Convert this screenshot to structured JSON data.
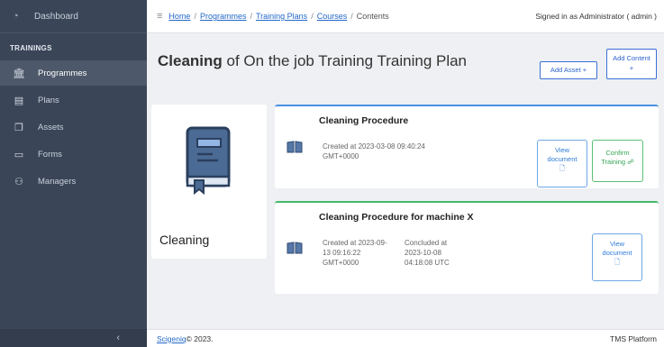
{
  "sidebar": {
    "dashboard": "Dashboard",
    "section": "TRAININGS",
    "items": [
      {
        "label": "Programmes"
      },
      {
        "label": "Plans"
      },
      {
        "label": "Assets"
      },
      {
        "label": "Forms"
      },
      {
        "label": "Managers"
      }
    ]
  },
  "header": {
    "breadcrumb": [
      "Home",
      "Programmes",
      "Training Plans",
      "Courses",
      "Contents"
    ],
    "signed_in": "Signed in as Administrator ( admin )"
  },
  "main": {
    "title_bold": "Cleaning",
    "title_rest": " of On the job Training Training Plan",
    "add_asset": "Add Asset +",
    "add_content_line1": "Add Content",
    "add_content_line2": "+",
    "course_name": "Cleaning",
    "procedures": [
      {
        "title": "Cleaning Procedure",
        "created_line1": "Created at 2023-03-08 09:40:24",
        "created_line2": "GMT+0000",
        "view_line1": "View",
        "view_line2": "document",
        "confirm_line1": "Confirm",
        "confirm_line2": "Training ☍"
      },
      {
        "title": "Cleaning Procedure for machine X",
        "created_line1": "Created at 2023-09-",
        "created_line2": "13 09:16:22",
        "created_line3": "GMT+0000",
        "concluded_line1": "Concluded at",
        "concluded_line2": "2023-10-08",
        "concluded_line3": "04:18:08 UTC",
        "view_line1": "View",
        "view_line2": "document"
      }
    ]
  },
  "footer": {
    "brand": "Scigeniq",
    "copyright": " © 2023.",
    "platform": "TMS Platform"
  }
}
